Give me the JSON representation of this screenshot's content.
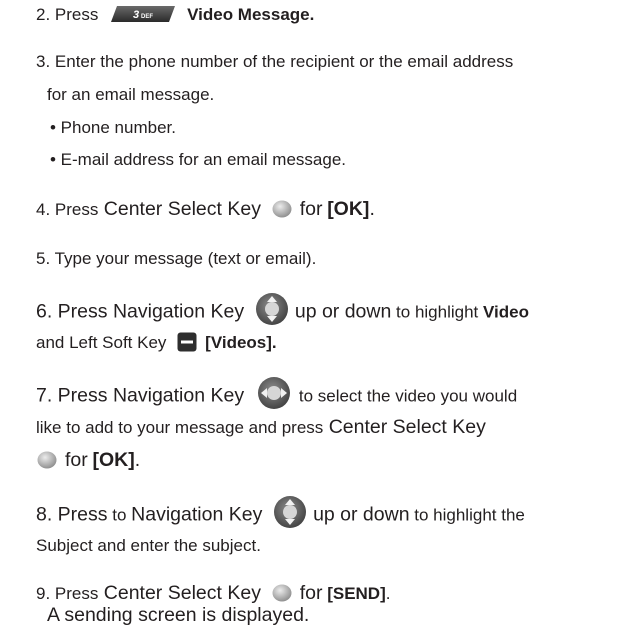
{
  "steps": {
    "s2": {
      "num": "2. Press",
      "bold": "Video Message."
    },
    "s3": {
      "line1": "3. Enter the phone number of the recipient or the email address",
      "line2": "for an email message.",
      "bullet1": "• Phone number.",
      "bullet2": "• E-mail address for an email message."
    },
    "s4": {
      "pre": "4. Press",
      "mid": " Center Select Key",
      "post": "for",
      "bold": "[OK]",
      "end": "."
    },
    "s5": {
      "text": "5. Type your message (text or email)."
    },
    "s6": {
      "pre": "6. Press Navigation Key",
      "ud": "up or down",
      "hl": " to highlight ",
      "bold": "Video",
      "line2a": "and Left Soft Key",
      "bold2": "[Videos]."
    },
    "s7": {
      "pre": "7. Press Navigation Key",
      "post": "to select the video you would",
      "line2a": "like to add to your message and press",
      "line2b": " Center Select Key",
      "line3a": "for",
      "bold": "[OK]",
      "end": "."
    },
    "s8": {
      "pre": "8. Press",
      "pre2": " to ",
      "pre3": "Navigation Key",
      "ud": "up or down",
      "post": " to highlight the",
      "line2": "Subject and enter the subject."
    },
    "s9": {
      "pre": "9. Press",
      "mid": " Center Select Key",
      "post": "for",
      "bold": "[SEND]",
      "end": ".",
      "line2": "A sending screen is displayed."
    }
  },
  "icons": {
    "key3_label": "3",
    "key3_sub": "DEF"
  },
  "colors": {
    "text": "#231f20",
    "key_dark": "#3a3a3a",
    "key_light": "#9a9a9a"
  }
}
